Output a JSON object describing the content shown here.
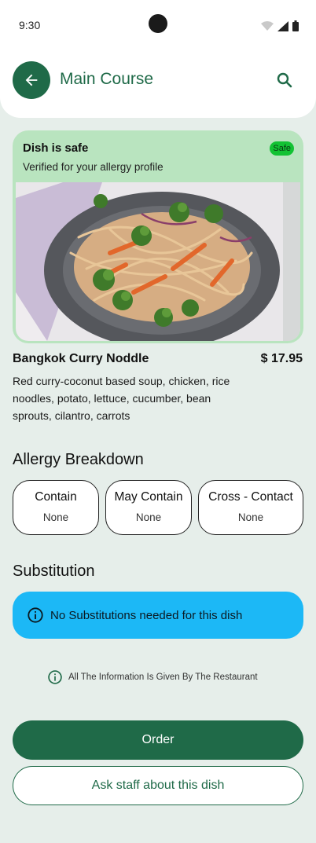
{
  "status_bar": {
    "time": "9:30",
    "icons": [
      "wifi-icon",
      "signal-icon",
      "battery-icon"
    ]
  },
  "header": {
    "title": "Main Course",
    "back_icon": "arrow-left-icon",
    "search_icon": "search-icon"
  },
  "safety": {
    "title": "Dish is safe",
    "subtitle": "Verified for your allergy profile",
    "badge": "Safe",
    "image_alt": "Bangkok Curry Noddle photo"
  },
  "dish": {
    "name": "Bangkok Curry Noddle",
    "price": "$ 17.95",
    "description": "Red curry-coconut based soup, chicken, rice noodles, potato, lettuce, cucumber, bean sprouts, cilantro, carrots"
  },
  "allergy": {
    "title": "Allergy Breakdown",
    "items": [
      {
        "label": "Contain",
        "value": "None"
      },
      {
        "label": "May Contain",
        "value": "None"
      },
      {
        "label": "Cross - Contact",
        "value": "None"
      }
    ]
  },
  "substitution": {
    "title": "Substitution",
    "message": "No Substitutions needed for this dish"
  },
  "note": "All The Information Is Given By The Restaurant",
  "actions": {
    "order": "Order",
    "ask": "Ask staff about this dish"
  },
  "colors": {
    "primary": "#1f6a48",
    "safe_bg": "#b9e4bf",
    "safe_badge": "#12c233",
    "info_banner": "#1cb8f6",
    "page_bg": "#e6eeea"
  }
}
